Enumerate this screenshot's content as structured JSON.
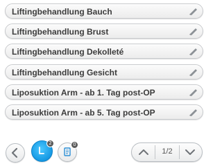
{
  "list": {
    "items": [
      {
        "label": "Liftingbehandlung Bauch",
        "icon": "edit-pen-icon"
      },
      {
        "label": "Liftingbehandlung Brust",
        "icon": "edit-pen-icon"
      },
      {
        "label": "Liftingbehandlung Dekolleté",
        "icon": "edit-pen-icon"
      },
      {
        "label": "Liftingbehandlung Gesicht",
        "icon": "edit-pen-icon"
      },
      {
        "label": "Liposuktion Arm - ab 1. Tag post-OP",
        "icon": "edit-pen-icon"
      },
      {
        "label": "Liposuktion Arm - ab 5. Tag post-OP",
        "icon": "edit-pen-icon"
      }
    ]
  },
  "toolbar": {
    "back_icon": "chevron-left-icon",
    "tool_a_badge": "2",
    "tool_b_badge": "0",
    "page_indicator": "1/2"
  },
  "colors": {
    "accent": "#1599e3",
    "badge": "#5a5a5a",
    "text": "#3c3c3c"
  }
}
